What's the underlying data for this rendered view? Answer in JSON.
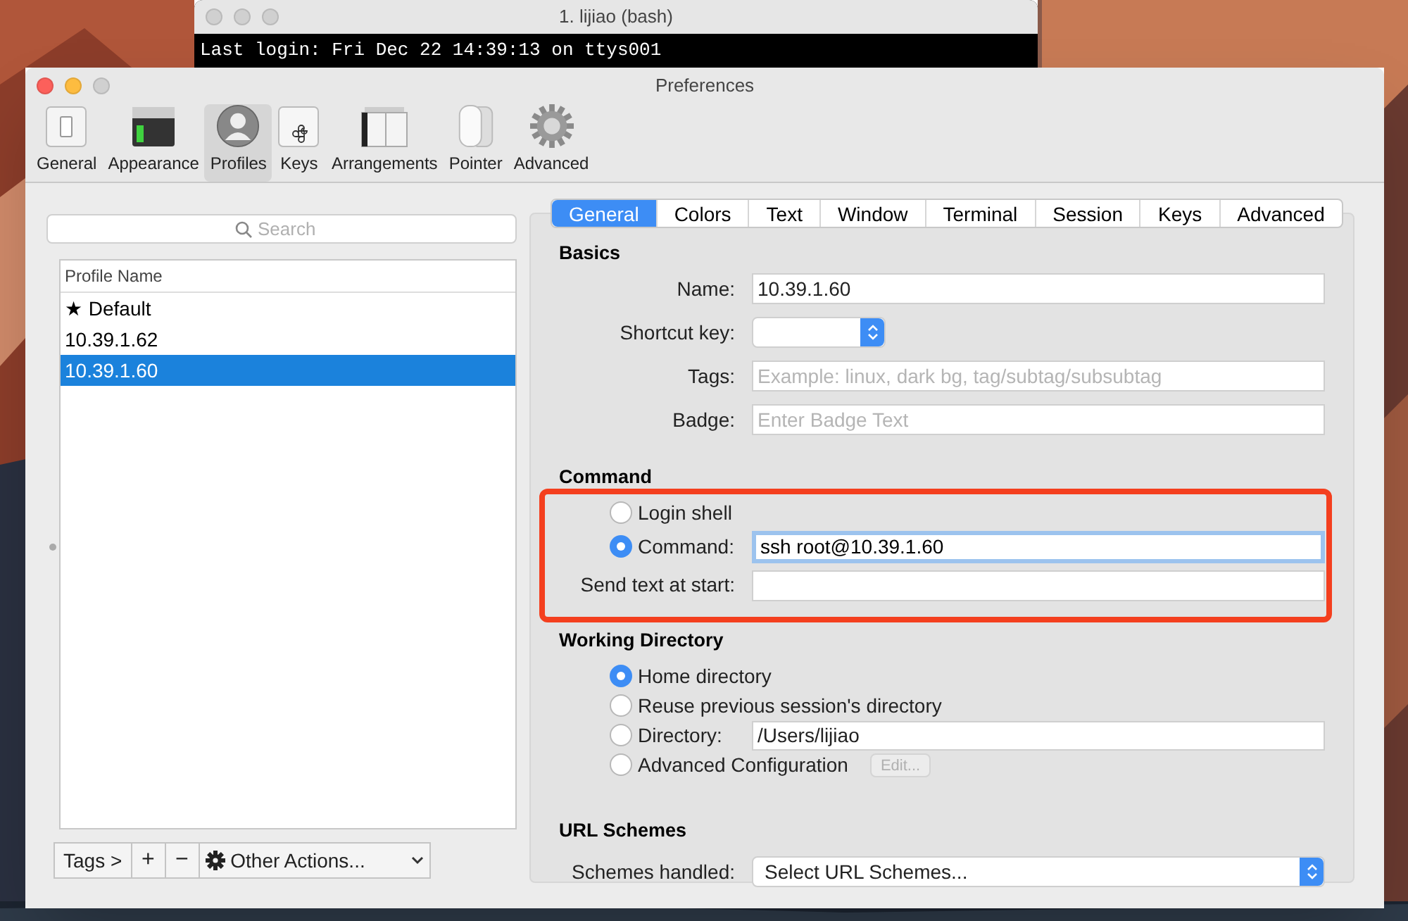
{
  "terminal": {
    "title": "1. lijiao (bash)",
    "lines": [
      "Last login: Fri Dec 22 14:39:13 on ttys001"
    ]
  },
  "window": {
    "title": "Preferences"
  },
  "toolbar": [
    {
      "label": "General",
      "selected": false
    },
    {
      "label": "Appearance",
      "selected": false
    },
    {
      "label": "Profiles",
      "selected": true
    },
    {
      "label": "Keys",
      "selected": false
    },
    {
      "label": "Arrangements",
      "selected": false
    },
    {
      "label": "Pointer",
      "selected": false
    },
    {
      "label": "Advanced",
      "selected": false
    }
  ],
  "search": {
    "placeholder": "Search"
  },
  "profiles": {
    "column": "Profile Name",
    "rows": [
      {
        "name": "★ Default",
        "selected": false
      },
      {
        "name": "10.39.1.62",
        "selected": false
      },
      {
        "name": "10.39.1.60",
        "selected": true
      }
    ]
  },
  "bottom_bar": {
    "tags": "Tags >",
    "add": "+",
    "remove": "−",
    "actions": "Other Actions..."
  },
  "tabs": [
    {
      "label": "General",
      "selected": true
    },
    {
      "label": "Colors",
      "selected": false
    },
    {
      "label": "Text",
      "selected": false
    },
    {
      "label": "Window",
      "selected": false
    },
    {
      "label": "Terminal",
      "selected": false
    },
    {
      "label": "Session",
      "selected": false
    },
    {
      "label": "Keys",
      "selected": false
    },
    {
      "label": "Advanced",
      "selected": false
    }
  ],
  "basics": {
    "title": "Basics",
    "fields": [
      {
        "label": "Name:",
        "kind": "text",
        "value": "10.39.1.60"
      },
      {
        "label": "Shortcut key:",
        "kind": "popup"
      },
      {
        "label": "Tags:",
        "kind": "text",
        "placeholder": "Example: linux, dark bg, tag/subtag/subsubtag"
      },
      {
        "label": "Badge:",
        "kind": "text",
        "placeholder": "Enter Badge Text"
      }
    ]
  },
  "command": {
    "title": "Command",
    "options": [
      {
        "label": "Login shell",
        "selected": false
      },
      {
        "label": "Command:",
        "selected": true,
        "value": "ssh root@10.39.1.60"
      }
    ],
    "send_text": {
      "label": "Send text at start:"
    }
  },
  "working_directory": {
    "title": "Working Directory",
    "options": [
      {
        "label": "Home directory",
        "selected": true,
        "kind": "plain"
      },
      {
        "label": "Reuse previous session's directory",
        "selected": false,
        "kind": "plain"
      },
      {
        "label": "Directory:",
        "selected": false,
        "kind": "field",
        "value": "/Users/lijiao"
      },
      {
        "label": "Advanced Configuration",
        "selected": false,
        "kind": "button",
        "button": "Edit...",
        "disabled": true
      }
    ]
  },
  "url_schemes": {
    "title": "URL Schemes",
    "label": "Schemes handled:",
    "value": "Select URL Schemes..."
  }
}
